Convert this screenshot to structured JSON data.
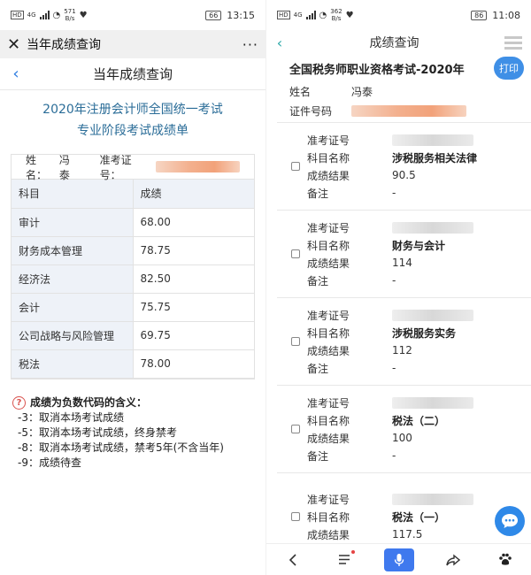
{
  "left": {
    "status": {
      "network": "4G",
      "speed": "571",
      "speed_unit": "B/s",
      "battery": "66",
      "time": "13:15"
    },
    "wechat_title": "当年成绩查询",
    "header_title": "当年成绩查询",
    "exam_title_line1": "2020年注册会计师全国统一考试",
    "exam_title_line2": "专业阶段考试成绩单",
    "name_label": "姓名：",
    "name_value": "冯泰",
    "ticket_label": "准考证号：",
    "table_headers": [
      "科目",
      "成绩"
    ],
    "rows": [
      {
        "subject": "审计",
        "score": "68.00"
      },
      {
        "subject": "财务成本管理",
        "score": "78.75"
      },
      {
        "subject": "经济法",
        "score": "82.50"
      },
      {
        "subject": "会计",
        "score": "75.75"
      },
      {
        "subject": "公司战略与风险管理",
        "score": "69.75"
      },
      {
        "subject": "税法",
        "score": "78.00"
      }
    ],
    "notes_title": "成绩为负数代码的含义：",
    "notes": [
      "-3：取消本场考试成绩",
      "-5：取消本场考试成绩，终身禁考",
      "-8：取消本场考试成绩，禁考5年(不含当年)",
      "-9：成绩待查"
    ]
  },
  "right": {
    "status": {
      "network": "4G",
      "speed": "362",
      "speed_unit": "B/s",
      "battery": "86",
      "time": "11:08"
    },
    "header_title": "成绩查询",
    "exam_name": "全国税务师职业资格考试-2020年",
    "print_label": "打印",
    "name_label": "姓名",
    "name_value": "冯泰",
    "id_label": "证件号码",
    "field_labels": {
      "ticket": "准考证号",
      "subject": "科目名称",
      "result": "成绩结果",
      "remark": "备注"
    },
    "records": [
      {
        "subject": "涉税服务相关法律",
        "result": "90.5",
        "remark": "-"
      },
      {
        "subject": "财务与会计",
        "result": "114",
        "remark": "-"
      },
      {
        "subject": "涉税服务实务",
        "result": "112",
        "remark": "-"
      },
      {
        "subject": "税法（二）",
        "result": "100",
        "remark": "-"
      },
      {
        "subject": "税法（一）",
        "result": "117.5",
        "remark": ""
      }
    ]
  }
}
